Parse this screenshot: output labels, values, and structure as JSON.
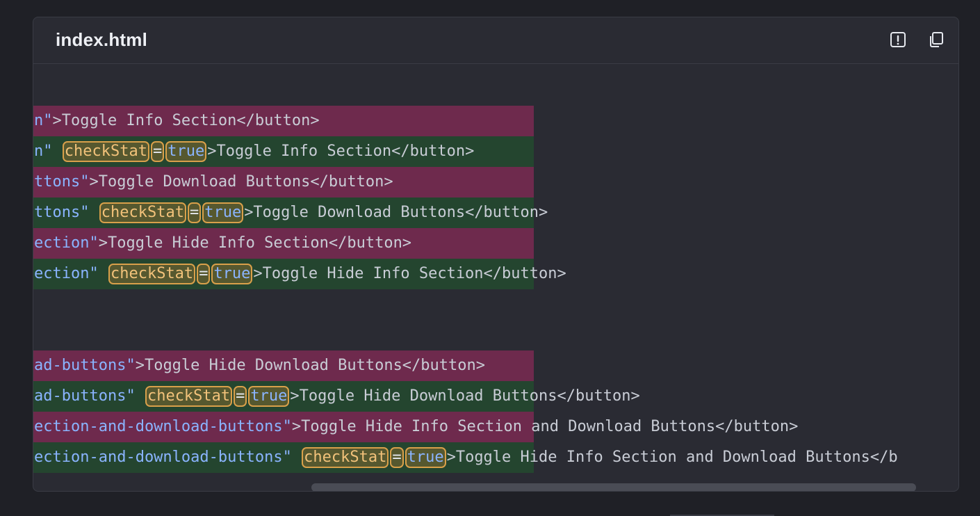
{
  "panel": {
    "filename": "index.html",
    "icons": {
      "report": "report-issue-icon",
      "copy": "copy-icon"
    }
  },
  "code_lines": [
    {
      "kind": "del",
      "prefix": "n\"",
      "after": ">Toggle Info Section</button>"
    },
    {
      "kind": "add",
      "prefix": "n\"",
      "key": "checkStat",
      "eq": "=",
      "val": "true",
      "after": ">Toggle Info Section</button>"
    },
    {
      "kind": "del",
      "prefix": "ttons\"",
      "after": ">Toggle Download Buttons</button>"
    },
    {
      "kind": "add",
      "prefix": "ttons\"",
      "key": "checkStat",
      "eq": "=",
      "val": "true",
      "after": ">Toggle Download Buttons</button>"
    },
    {
      "kind": "del",
      "prefix": "ection\"",
      "after": ">Toggle Hide Info Section</button>"
    },
    {
      "kind": "add",
      "prefix": "ection\"",
      "key": "checkStat",
      "eq": "=",
      "val": "true",
      "after": ">Toggle Hide Info Section</button>"
    },
    {
      "kind": "gap"
    },
    {
      "kind": "del",
      "prefix": "ad-buttons\"",
      "after": ">Toggle Hide Download Buttons</button>"
    },
    {
      "kind": "add",
      "prefix": "ad-buttons\"",
      "key": "checkStat",
      "eq": "=",
      "val": "true",
      "after": ">Toggle Hide Download Buttons</button>"
    },
    {
      "kind": "del",
      "prefix": "ection-and-download-buttons\"",
      "after": ">Toggle Hide Info Section and Download Buttons</button>"
    },
    {
      "kind": "add",
      "prefix": "ection-and-download-buttons\"",
      "key": "checkStat",
      "eq": "=",
      "val": "true",
      "after": ">Toggle Hide Info Section and Download Buttons</b"
    }
  ],
  "colors": {
    "deleted_line": "#6e2a4d",
    "added_line": "#24452f",
    "attribute": "#8ab4ff",
    "token_border": "#d9a04a"
  }
}
